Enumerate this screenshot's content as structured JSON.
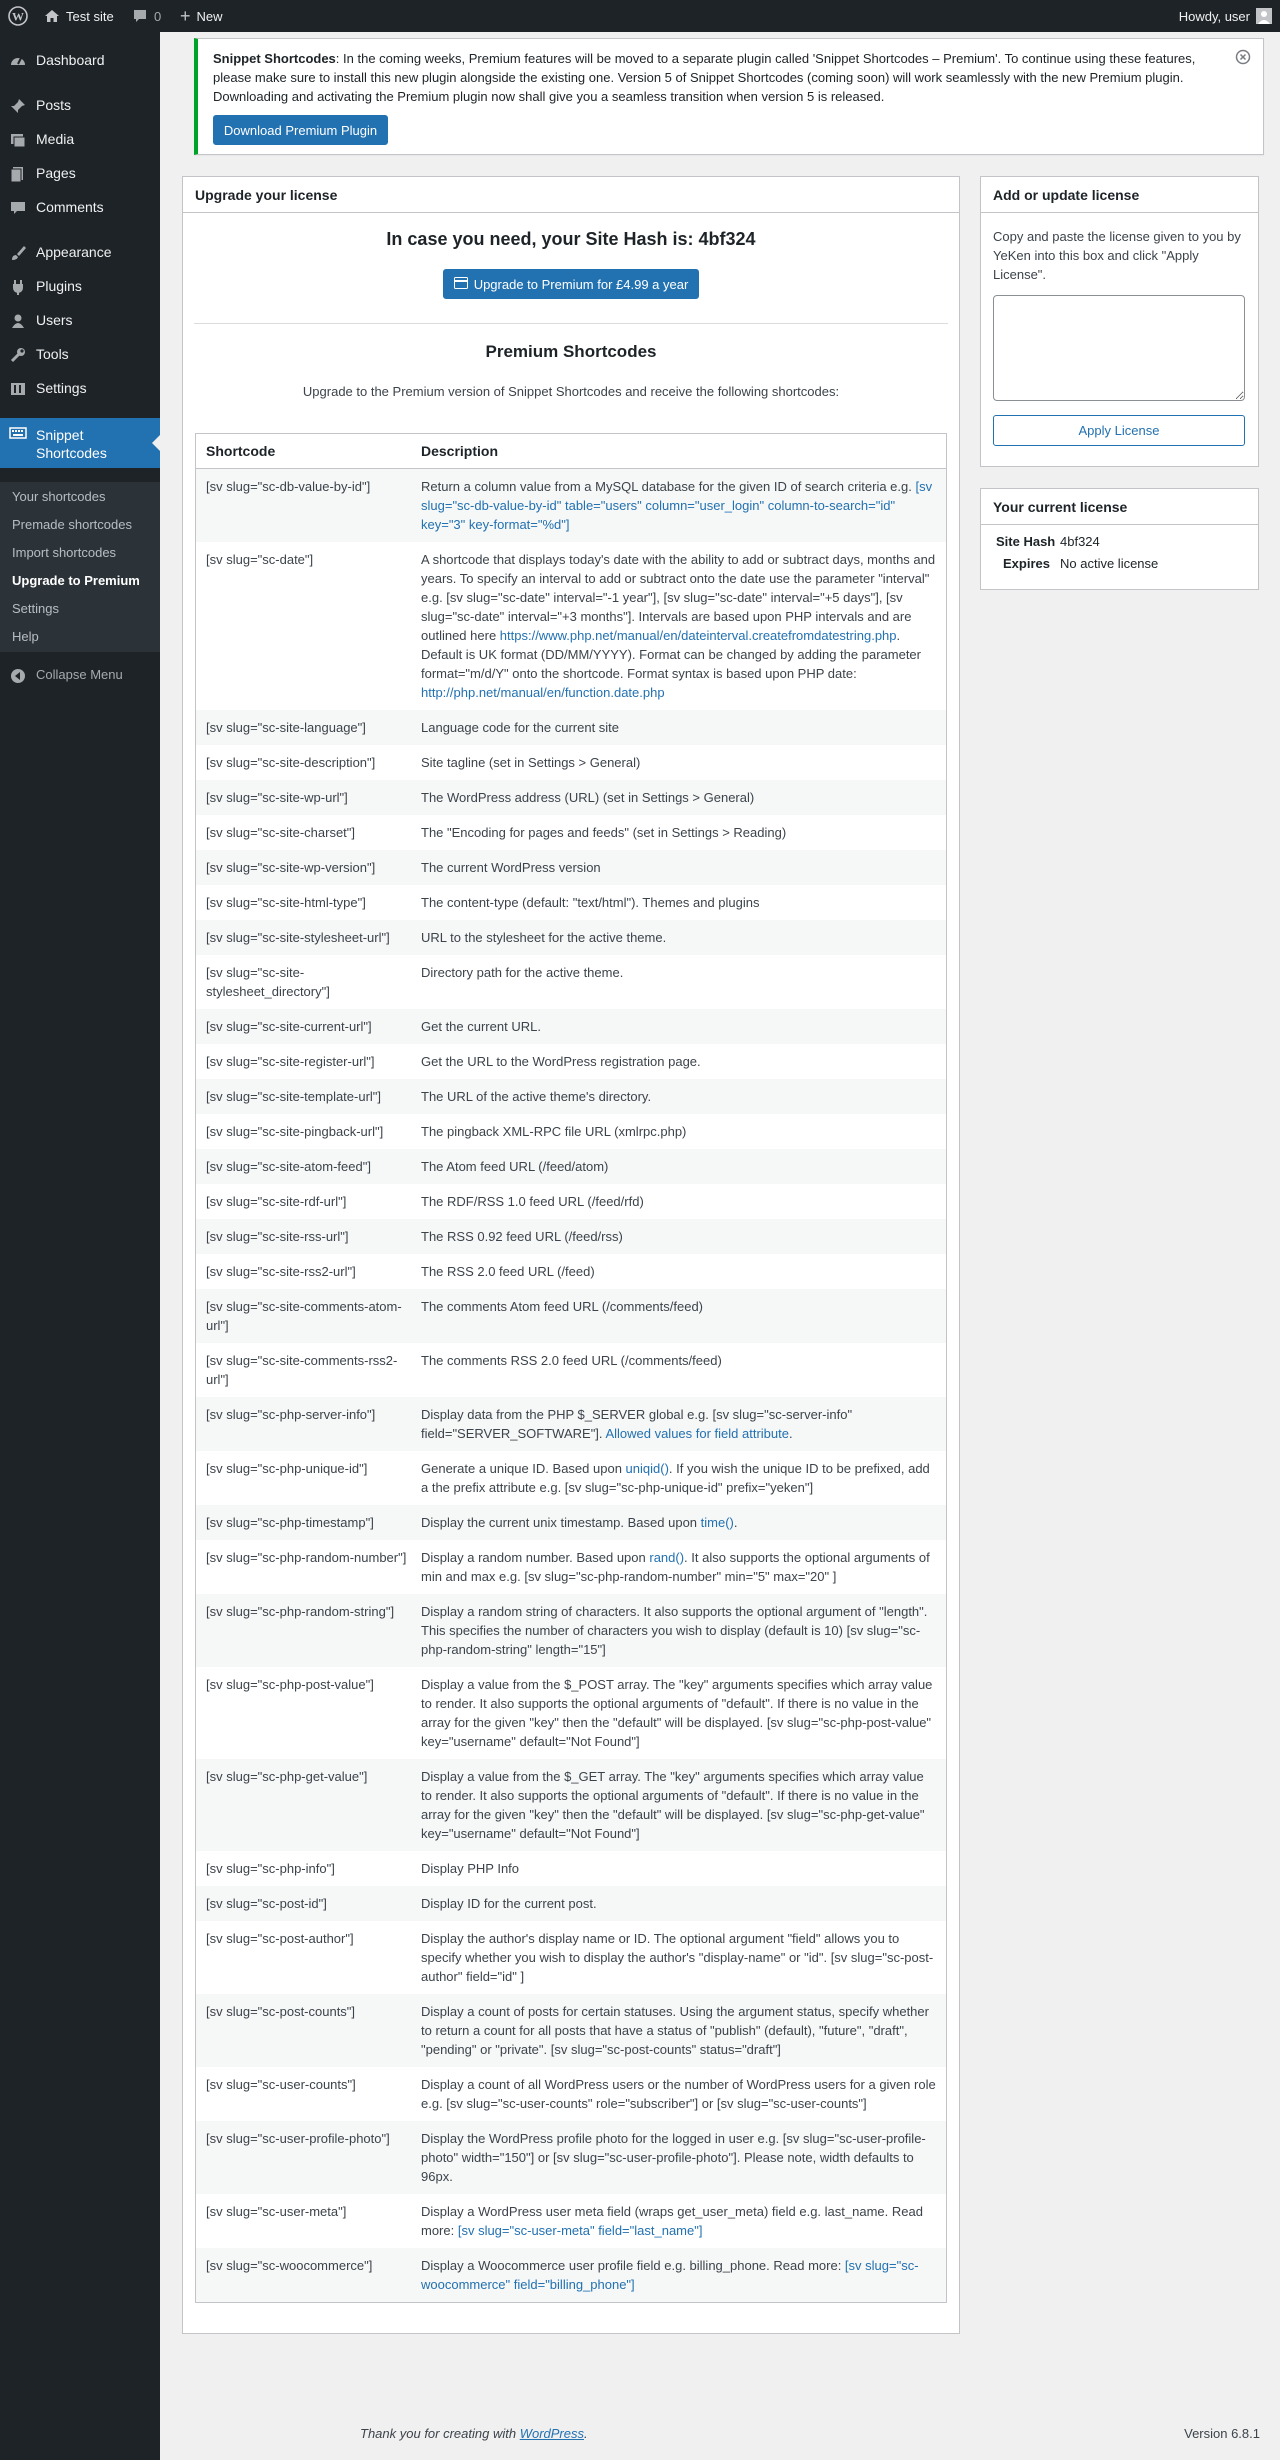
{
  "adminbar": {
    "site_name": "Test site",
    "comments_count": "0",
    "new_label": "New",
    "howdy": "Howdy, user"
  },
  "menu": {
    "dashboard": "Dashboard",
    "posts": "Posts",
    "media": "Media",
    "pages": "Pages",
    "comments": "Comments",
    "appearance": "Appearance",
    "plugins": "Plugins",
    "users": "Users",
    "tools": "Tools",
    "settings": "Settings",
    "snippet": "Snippet Shortcodes",
    "submenu": [
      "Your shortcodes",
      "Premade shortcodes",
      "Import shortcodes",
      "Upgrade to Premium",
      "Settings",
      "Help"
    ],
    "collapse": "Collapse Menu"
  },
  "notice": {
    "title": "Snippet Shortcodes",
    "text": ": In the coming weeks, Premium features will be moved to a separate plugin called 'Snippet Shortcodes – Premium'. To continue using these features, please make sure to install this new plugin alongside the existing one. Version 5 of Snippet Shortcodes (coming soon) will work seamlessly with the new Premium plugin. Downloading and activating the Premium plugin now shall give you a seamless transition when version 5 is released.",
    "button": "Download Premium Plugin"
  },
  "upgrade": {
    "box_title": "Upgrade your license",
    "hash_text": "In case you need, your Site Hash is: 4bf324",
    "button": "Upgrade to Premium for £4.99 a year",
    "premium_title": "Premium Shortcodes",
    "premium_desc": "Upgrade to the Premium version of Snippet Shortcodes and receive the following shortcodes:"
  },
  "table": {
    "headers": [
      "Shortcode",
      "Description"
    ],
    "rows": [
      {
        "code": "[sv slug=\"sc-db-value-by-id\"]",
        "desc": "Return a column value from a MySQL database for the given ID of search criteria e.g. ",
        "link": "[sv slug=\"sc-db-value-by-id\" table=\"users\" column=\"user_login\" column-to-search=\"id\" key=\"3\" key-format=\"%d\"]",
        "after": ""
      },
      {
        "code": "[sv slug=\"sc-date\"]",
        "desc": "A shortcode that displays today's date with the ability to add or subtract days, months and years. To specify an interval to add or subtract onto the date use the parameter \"interval\" e.g. [sv slug=\"sc-date\" interval=\"-1 year\"], [sv slug=\"sc-date\" interval=\"+5 days\"], [sv slug=\"sc-date\" interval=\"+3 months\"]. Intervals are based upon PHP intervals and are outlined here ",
        "link": "https://www.php.net/manual/en/dateinterval.createfromdatestring.php",
        "after": ". Default is UK format (DD/MM/YYYY). Format can be changed by adding the parameter format=\"m/d/Y\" onto the shortcode. Format syntax is based upon PHP date: ",
        "link2": "http://php.net/manual/en/function.date.php"
      },
      {
        "code": "[sv slug=\"sc-site-language\"]",
        "desc": "Language code for the current site"
      },
      {
        "code": "[sv slug=\"sc-site-description\"]",
        "desc": "Site tagline (set in Settings > General)"
      },
      {
        "code": "[sv slug=\"sc-site-wp-url\"]",
        "desc": "The WordPress address (URL) (set in Settings > General)"
      },
      {
        "code": "[sv slug=\"sc-site-charset\"]",
        "desc": "The \"Encoding for pages and feeds\" (set in Settings > Reading)"
      },
      {
        "code": "[sv slug=\"sc-site-wp-version\"]",
        "desc": "The current WordPress version"
      },
      {
        "code": "[sv slug=\"sc-site-html-type\"]",
        "desc": "The content-type (default: \"text/html\"). Themes and plugins"
      },
      {
        "code": "[sv slug=\"sc-site-stylesheet-url\"]",
        "desc": "URL to the stylesheet for the active theme."
      },
      {
        "code": "[sv slug=\"sc-site-stylesheet_directory\"]",
        "desc": "Directory path for the active theme."
      },
      {
        "code": "[sv slug=\"sc-site-current-url\"]",
        "desc": "Get the current URL."
      },
      {
        "code": "[sv slug=\"sc-site-register-url\"]",
        "desc": "Get the URL to the WordPress registration page."
      },
      {
        "code": "[sv slug=\"sc-site-template-url\"]",
        "desc": "The URL of the active theme's directory."
      },
      {
        "code": "[sv slug=\"sc-site-pingback-url\"]",
        "desc": "The pingback XML-RPC file URL (xmlrpc.php)"
      },
      {
        "code": "[sv slug=\"sc-site-atom-feed\"]",
        "desc": "The Atom feed URL (/feed/atom)"
      },
      {
        "code": "[sv slug=\"sc-site-rdf-url\"]",
        "desc": "The RDF/RSS 1.0 feed URL (/feed/rfd)"
      },
      {
        "code": "[sv slug=\"sc-site-rss-url\"]",
        "desc": "The RSS 0.92 feed URL (/feed/rss)"
      },
      {
        "code": "[sv slug=\"sc-site-rss2-url\"]",
        "desc": "The RSS 2.0 feed URL (/feed)"
      },
      {
        "code": "[sv slug=\"sc-site-comments-atom-url\"]",
        "desc": "The comments Atom feed URL (/comments/feed)"
      },
      {
        "code": "[sv slug=\"sc-site-comments-rss2-url\"]",
        "desc": "The comments RSS 2.0 feed URL (/comments/feed)"
      },
      {
        "code": "[sv slug=\"sc-php-server-info\"]",
        "desc": "Display data from the PHP $_SERVER global e.g. [sv slug=\"sc-server-info\" field=\"SERVER_SOFTWARE\"]. ",
        "link": "Allowed values for field attribute",
        "after": "."
      },
      {
        "code": "[sv slug=\"sc-php-unique-id\"]",
        "desc": "Generate a unique ID. Based upon ",
        "link": "uniqid()",
        "after": ". If you wish the unique ID to be prefixed, add a the prefix attribute e.g. [sv slug=\"sc-php-unique-id\" prefix=\"yeken\"]"
      },
      {
        "code": "[sv slug=\"sc-php-timestamp\"]",
        "desc": "Display the current unix timestamp. Based upon ",
        "link": "time()",
        "after": "."
      },
      {
        "code": "[sv slug=\"sc-php-random-number\"]",
        "desc": "Display a random number. Based upon ",
        "link": "rand()",
        "after": ". It also supports the optional arguments of min and max e.g. [sv slug=\"sc-php-random-number\" min=\"5\" max=\"20\" ]"
      },
      {
        "code": "[sv slug=\"sc-php-random-string\"]",
        "desc": "Display a random string of characters. It also supports the optional argument of \"length\". This specifies the number of characters you wish to display (default is 10) [sv slug=\"sc-php-random-string\" length=\"15\"]"
      },
      {
        "code": "[sv slug=\"sc-php-post-value\"]",
        "desc": "Display a value from the $_POST array. The \"key\" arguments specifies which array value to render. It also supports the optional arguments of \"default\". If there is no value in the array for the given \"key\" then the \"default\" will be displayed. [sv slug=\"sc-php-post-value\" key=\"username\" default=\"Not Found\"]"
      },
      {
        "code": "[sv slug=\"sc-php-get-value\"]",
        "desc": "Display a value from the $_GET array. The \"key\" arguments specifies which array value to render. It also supports the optional arguments of \"default\". If there is no value in the array for the given \"key\" then the \"default\" will be displayed. [sv slug=\"sc-php-get-value\" key=\"username\" default=\"Not Found\"]"
      },
      {
        "code": "[sv slug=\"sc-php-info\"]",
        "desc": "Display PHP Info"
      },
      {
        "code": "[sv slug=\"sc-post-id\"]",
        "desc": "Display ID for the current post."
      },
      {
        "code": "[sv slug=\"sc-post-author\"]",
        "desc": "Display the author's display name or ID. The optional argument \"field\" allows you to specify whether you wish to display the author's \"display-name\" or \"id\". [sv slug=\"sc-post-author\" field=\"id\" ]"
      },
      {
        "code": "[sv slug=\"sc-post-counts\"]",
        "desc": "Display a count of posts for certain statuses. Using the argument status, specify whether to return a count for all posts that have a status of \"publish\" (default), \"future\", \"draft\", \"pending\" or \"private\". [sv slug=\"sc-post-counts\" status=\"draft\"]"
      },
      {
        "code": "[sv slug=\"sc-user-counts\"]",
        "desc": "Display a count of all WordPress users or the number of WordPress users for a given role e.g. [sv slug=\"sc-user-counts\" role=\"subscriber\"] or [sv slug=\"sc-user-counts\"]"
      },
      {
        "code": "[sv slug=\"sc-user-profile-photo\"]",
        "desc": "Display the WordPress profile photo for the logged in user e.g. [sv slug=\"sc-user-profile-photo\" width=\"150\"] or [sv slug=\"sc-user-profile-photo\"]. Please note, width defaults to 96px."
      },
      {
        "code": "[sv slug=\"sc-user-meta\"]",
        "desc": "Display a WordPress user meta field (wraps get_user_meta) field e.g. last_name. Read more: ",
        "link": "[sv slug=\"sc-user-meta\" field=\"last_name\"]",
        "after": ""
      },
      {
        "code": "[sv slug=\"sc-woocommerce\"]",
        "desc": "Display a Woocommerce user profile field e.g. billing_phone. Read more: ",
        "link": "[sv slug=\"sc-woocommerce\" field=\"billing_phone\"]",
        "after": ""
      }
    ]
  },
  "license": {
    "box_title": "Add or update license",
    "text": "Copy and paste the license given to you by YeKen into this box and click \"Apply License\".",
    "textarea_value": "",
    "button": "Apply License"
  },
  "current_license": {
    "box_title": "Your current license",
    "hash_label": "Site Hash",
    "hash_value": "4bf324",
    "expires_label": "Expires",
    "expires_value": "No active license"
  },
  "footer": {
    "thanks_before": "Thank you for creating with ",
    "thanks_link": "WordPress",
    "thanks_after": ".",
    "version": "Version 6.8.1"
  },
  "colors": {
    "accent": "#2271b1",
    "menu_bg": "#1d2327",
    "submenu_bg": "#2c3338",
    "notice_border": "#00a32a"
  }
}
